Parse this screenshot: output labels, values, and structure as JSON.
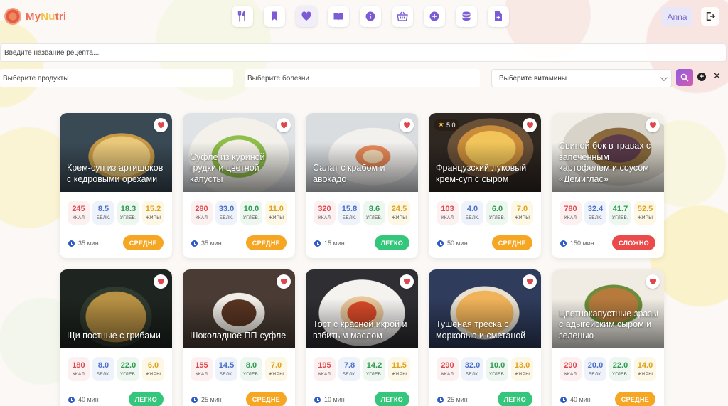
{
  "app": {
    "logo_text_a": "My",
    "logo_text_b": "Nu",
    "logo_text_c": "tri"
  },
  "nav": [
    {
      "icon": "fork-knife-icon"
    },
    {
      "icon": "bookmark-icon"
    },
    {
      "icon": "heart-icon"
    },
    {
      "icon": "book-icon"
    },
    {
      "icon": "info-icon"
    },
    {
      "icon": "basket-icon"
    },
    {
      "icon": "plus-circle-icon"
    },
    {
      "icon": "database-icon"
    },
    {
      "icon": "document-icon"
    }
  ],
  "user": {
    "name": "Anna"
  },
  "filters": {
    "recipe_placeholder": "Введите название рецепта...",
    "products_placeholder": "Выберите продукты",
    "diseases_placeholder": "Выберите болезни",
    "vitamins_value": "Выберите витамины"
  },
  "colors": {
    "accent": "#8f5fe0",
    "easy": "#34c67a",
    "medium": "#f5a623",
    "hard": "#ea4a4a"
  },
  "labels": {
    "kcal": "ККАЛ",
    "prot": "БЕЛК.",
    "carb": "УГЛЕВ.",
    "fat": "ЖИРЫ"
  },
  "recipes": [
    {
      "title": "Крем-суп из артишоков с кедровыми орехами",
      "kcal": "245",
      "prot": "8.5",
      "carb": "18.3",
      "fat": "15.2",
      "time": "35 мин",
      "difficulty": "СРЕДНЕ",
      "level": "medium",
      "rating": ""
    },
    {
      "title": "Суфле из куриной грудки и цветной капусты",
      "kcal": "280",
      "prot": "33.0",
      "carb": "10.0",
      "fat": "11.0",
      "time": "35 мин",
      "difficulty": "СРЕДНЕ",
      "level": "medium",
      "rating": ""
    },
    {
      "title": "Салат с крабом и авокадо",
      "kcal": "320",
      "prot": "15.8",
      "carb": "8.6",
      "fat": "24.5",
      "time": "15 мин",
      "difficulty": "ЛЕГКО",
      "level": "easy",
      "rating": ""
    },
    {
      "title": "Французский луковый крем-суп с сыром",
      "kcal": "103",
      "prot": "4.0",
      "carb": "6.0",
      "fat": "7.0",
      "time": "50 мин",
      "difficulty": "СРЕДНЕ",
      "level": "medium",
      "rating": "5.0"
    },
    {
      "title": "Свиной бок в травах с запечённым картофелем и соусом «Демиглас»",
      "kcal": "780",
      "prot": "32.4",
      "carb": "41.7",
      "fat": "52.5",
      "time": "150 мин",
      "difficulty": "СЛОЖНО",
      "level": "hard",
      "rating": ""
    },
    {
      "title": "Щи постные с грибами",
      "kcal": "180",
      "prot": "8.0",
      "carb": "22.0",
      "fat": "6.0",
      "time": "40 мин",
      "difficulty": "ЛЕГКО",
      "level": "easy",
      "rating": ""
    },
    {
      "title": "Шоколадное ПП-суфле",
      "kcal": "155",
      "prot": "14.5",
      "carb": "8.0",
      "fat": "7.0",
      "time": "25 мин",
      "difficulty": "СРЕДНЕ",
      "level": "medium",
      "rating": ""
    },
    {
      "title": "Тост с красной икрой и взбитым маслом",
      "kcal": "195",
      "prot": "7.8",
      "carb": "14.2",
      "fat": "11.5",
      "time": "10 мин",
      "difficulty": "ЛЕГКО",
      "level": "easy",
      "rating": ""
    },
    {
      "title": "Тушеная треска с морковью и сметаной",
      "kcal": "290",
      "prot": "32.0",
      "carb": "10.0",
      "fat": "13.0",
      "time": "25 мин",
      "difficulty": "ЛЕГКО",
      "level": "easy",
      "rating": ""
    },
    {
      "title": "Цветнокапустные зразы с адыгейским сыром и зеленью",
      "kcal": "290",
      "prot": "20.0",
      "carb": "22.0",
      "fat": "14.0",
      "time": "40 мин",
      "difficulty": "СРЕДНЕ",
      "level": "medium",
      "rating": ""
    }
  ]
}
